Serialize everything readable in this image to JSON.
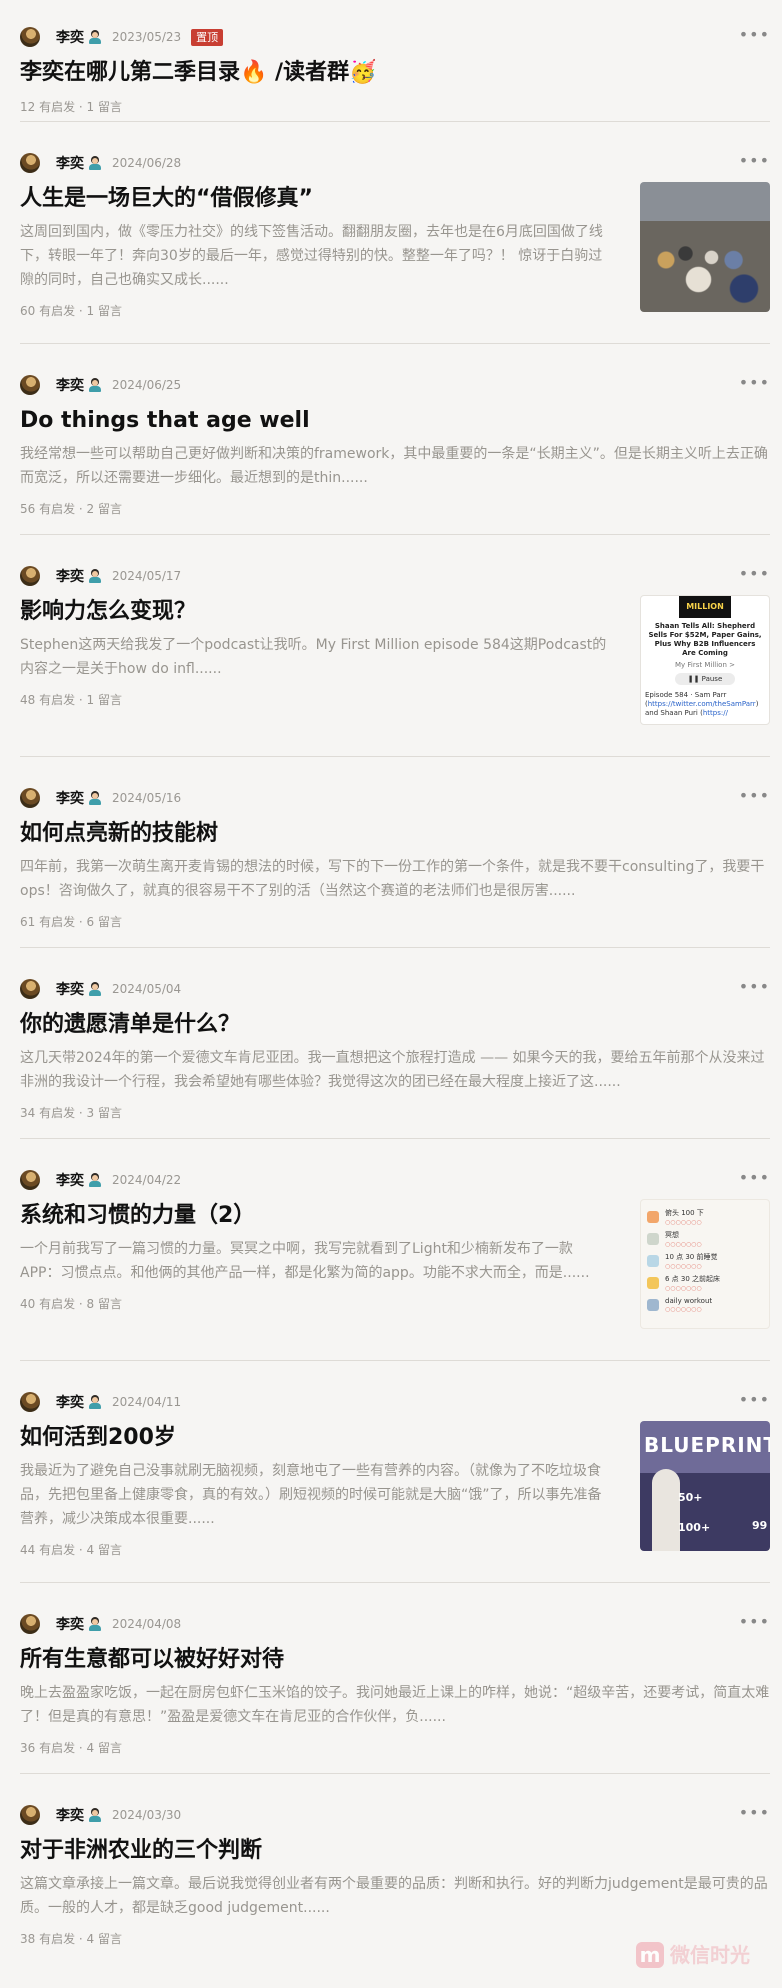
{
  "posts": [
    {
      "author": "李奕",
      "date": "2023/05/23",
      "badge": "置顶",
      "title": "李奕在哪儿第二季目录🔥 /读者群🥳",
      "excerpt": "",
      "stats": "12 有启发 · 1 留言",
      "thumb": null
    },
    {
      "author": "李奕",
      "date": "2024/06/28",
      "title": "人生是一场巨大的“借假修真”",
      "excerpt": "这周回到国内，做《零压力社交》的线下签售活动。翻翻朋友圈，去年也是在6月底回国做了线下，转眼一年了！奔向30岁的最后一年，感觉过得特别的快。整整一年了吗？！ 惊讶于白驹过隙的同时，自己也确实又成长......",
      "stats": "60 有启发 · 1 留言",
      "thumb": "crowd"
    },
    {
      "author": "李奕",
      "date": "2024/06/25",
      "title": "Do things that age well",
      "excerpt": "我经常想一些可以帮助自己更好做判断和决策的framework，其中最重要的一条是“长期主义”。但是长期主义听上去正确而宽泛，所以还需要进一步细化。最近想到的是thin......",
      "stats": "56 有启发 · 2 留言",
      "thumb": null
    },
    {
      "author": "李奕",
      "date": "2024/05/17",
      "title": "影响力怎么变现？",
      "excerpt": "Stephen这两天给我发了一个podcast让我听。My First Million episode 584这期Podcast的内容之一是关于how do infl......",
      "stats": "48 有启发 · 1 留言",
      "thumb": "podcast"
    },
    {
      "author": "李奕",
      "date": "2024/05/16",
      "title": "如何点亮新的技能树",
      "excerpt": "四年前，我第一次萌生离开麦肯锡的想法的时候，写下的下一份工作的第一个条件，就是我不要干consulting了，我要干ops！咨询做久了，就真的很容易干不了别的活（当然这个赛道的老法师们也是很厉害......",
      "stats": "61 有启发 · 6 留言",
      "thumb": null
    },
    {
      "author": "李奕",
      "date": "2024/05/04",
      "title": "你的遗愿清单是什么？",
      "excerpt": "这几天带2024年的第一个爱德文车肯尼亚团。我一直想把这个旅程打造成 —— 如果今天的我，要给五年前那个从没来过非洲的我设计一个行程，我会希望她有哪些体验？我觉得这次的团已经在最大程度上接近了这......",
      "stats": "34 有启发 · 3 留言",
      "thumb": null
    },
    {
      "author": "李奕",
      "date": "2024/04/22",
      "title": "系统和习惯的力量（2）",
      "excerpt": "一个月前我写了一篇习惯的力量。冥冥之中啊，我写完就看到了Light和少楠新发布了一款APP：习惯点点。和他俩的其他产品一样，都是化繁为简的app。功能不求大而全，而是......",
      "stats": "40 有启发 · 8 留言",
      "thumb": "habits"
    },
    {
      "author": "李奕",
      "date": "2024/04/11",
      "title": "如何活到200岁",
      "excerpt": "我最近为了避免自己没事就刷无脑视频，刻意地屯了一些有营养的内容。（就像为了不吃垃圾食品，先把包里备上健康零食，真的有效。）刷短视频的时候可能就是大脑“饿”了，所以事先准备营养，减少决策成本很重要......",
      "stats": "44 有启发 · 4 留言",
      "thumb": "blueprint"
    },
    {
      "author": "李奕",
      "date": "2024/04/08",
      "title": "所有生意都可以被好好对待",
      "excerpt": "晚上去盈盈家吃饭，一起在厨房包虾仁玉米馅的饺子。我问她最近上课上的咋样，她说：“超级辛苦，还要考试，简直太难了！但是真的有意思！”盈盈是爱德文车在肯尼亚的合作伙伴，负......",
      "stats": "36 有启发 · 4 留言",
      "thumb": null
    },
    {
      "author": "李奕",
      "date": "2024/03/30",
      "title": "对于非洲农业的三个判断",
      "excerpt": "这篇文章承接上一篇文章。最后说我觉得创业者有两个最重要的品质：判断和执行。好的判断力judgement是最可贵的品质。一般的人才，都是缺乏good judgement......",
      "stats": "38 有启发 · 4 留言",
      "thumb": null
    }
  ],
  "thumb_text": {
    "podcast": {
      "cover": "MILLION",
      "title": "Shaan Tells All: Shepherd Sells For $52M, Paper Gains, Plus Why B2B Influencers Are Coming",
      "show": "My First Million >",
      "button": "❚❚ Pause",
      "episode": "Episode 584 · Sam Parr (",
      "episode_link1": "https://twitter.com/theSamParr",
      "episode_mid": ") and Shaan Puri (",
      "episode_link2": "https://"
    },
    "habits": [
      {
        "label": "俯头 100 下",
        "color": "#f2a66a"
      },
      {
        "label": "冥想",
        "color": "#cfd6cc"
      },
      {
        "label": "10 点 30 前睡觉",
        "color": "#b9d7e6"
      },
      {
        "label": "6 点 30 之前起床",
        "color": "#f3c65a"
      },
      {
        "label": "daily workout",
        "color": "#9fb7cf"
      }
    ],
    "blueprint": {
      "title": "BLUEPRINT",
      "nums": [
        "50+",
        "100+",
        "99"
      ]
    }
  },
  "more_glyph": "•••",
  "watermark": {
    "letter": "m",
    "text": "微信时光"
  }
}
